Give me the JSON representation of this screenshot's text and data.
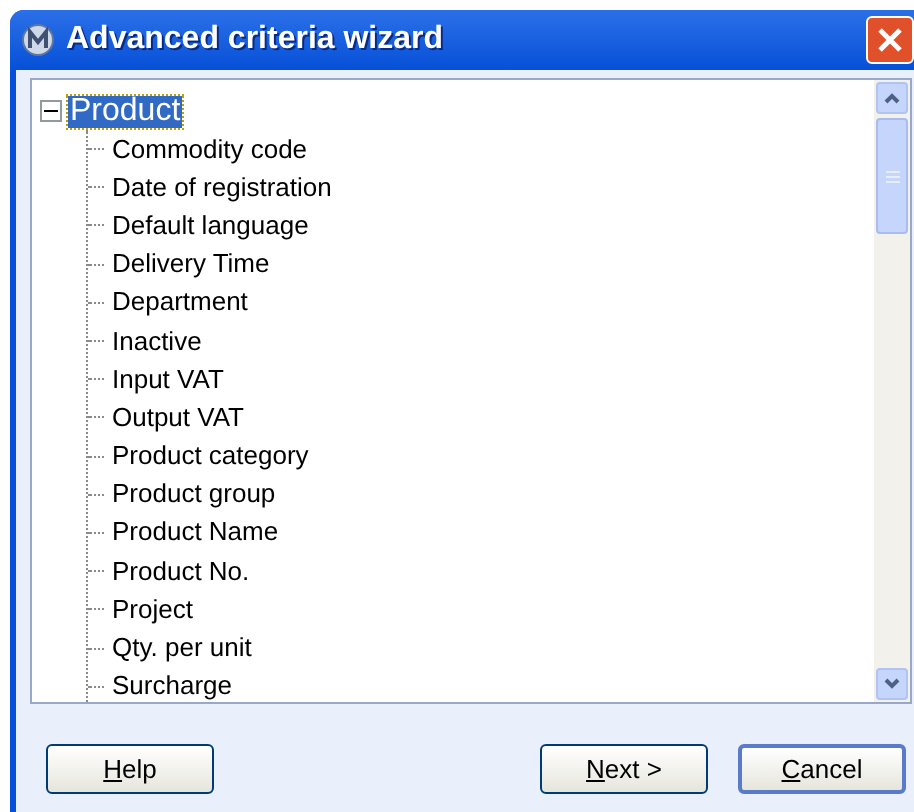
{
  "window": {
    "title": "Advanced criteria wizard"
  },
  "tree": {
    "label": "Product",
    "expanded": true,
    "selected": true,
    "children": [
      {
        "label": "Commodity code",
        "selected": false
      },
      {
        "label": "Date of registration",
        "selected": false
      },
      {
        "label": "Default language",
        "selected": false
      },
      {
        "label": "Delivery Time",
        "selected": false
      },
      {
        "label": "Department",
        "selected": false
      },
      {
        "label": "Inactive",
        "selected": false
      },
      {
        "label": "Input VAT",
        "selected": false
      },
      {
        "label": "Output VAT",
        "selected": false
      },
      {
        "label": "Product category",
        "selected": false
      },
      {
        "label": "Product group",
        "selected": false
      },
      {
        "label": "Product Name",
        "selected": false
      },
      {
        "label": "Product No.",
        "selected": false
      },
      {
        "label": "Project",
        "selected": false
      },
      {
        "label": "Qty. per unit",
        "selected": false
      },
      {
        "label": "Surcharge",
        "selected": false
      }
    ]
  },
  "buttons": [
    {
      "accel": "H",
      "rest": "elp",
      "default": false
    },
    {
      "accel": "N",
      "rest": "ext >",
      "default": false
    },
    {
      "accel": "C",
      "rest": "ancel",
      "default": true
    }
  ]
}
